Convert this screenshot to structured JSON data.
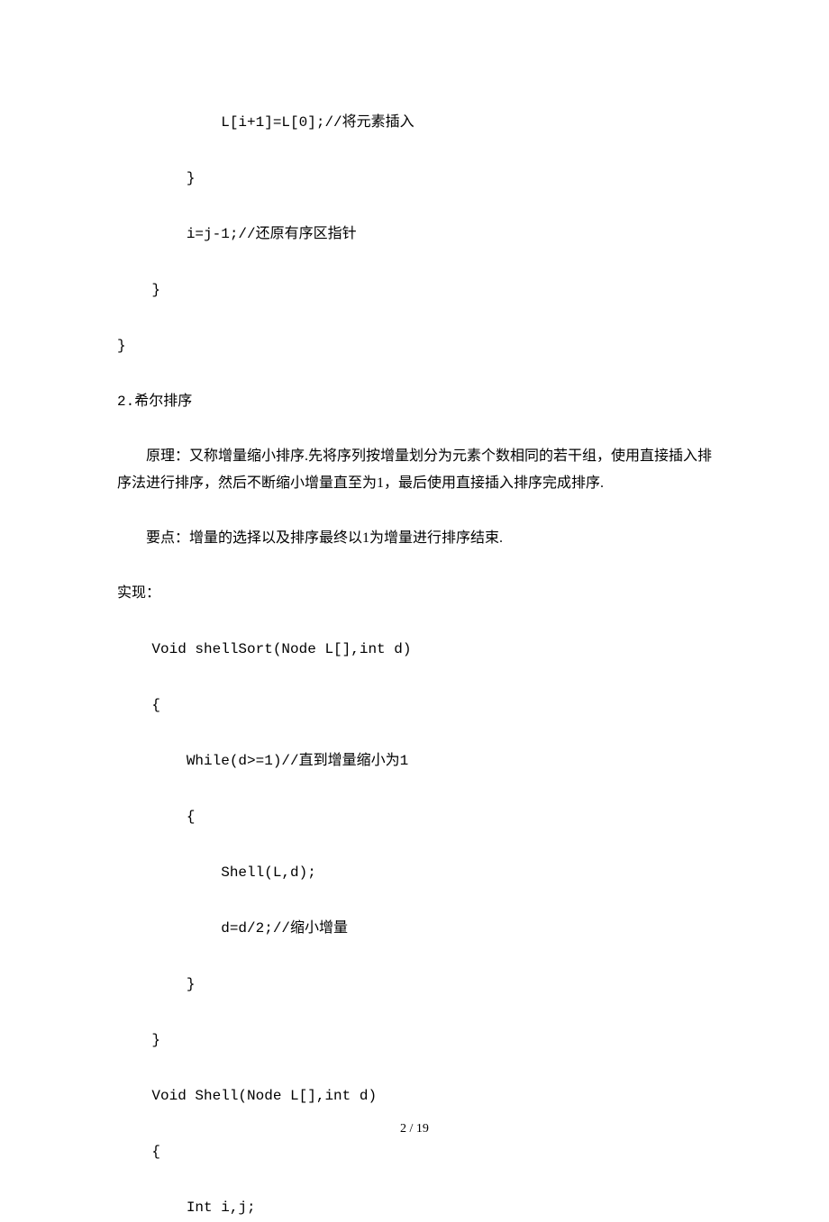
{
  "lines": {
    "l1": "            L[i+1]=L[0];//将元素插入",
    "l2": "        }",
    "l3": "        i=j-1;//还原有序区指针",
    "l4": "    }",
    "l5": "}",
    "l6": "2.希尔排序",
    "l7": "原理：又称增量缩小排序.先将序列按增量划分为元素个数相同的若干组，使用直接插入排序法进行排序，然后不断缩小增量直至为1，最后使用直接插入排序完成排序.",
    "l8": "要点：增量的选择以及排序最终以1为增量进行排序结束.",
    "l9": "实现：",
    "l10": "    Void shellSort(Node L[],int d)",
    "l11": "    {",
    "l12": "        While(d>=1)//直到增量缩小为1",
    "l13": "        {",
    "l14": "            Shell(L,d);",
    "l15": "            d=d/2;//缩小增量",
    "l16": "        }",
    "l17": "    }",
    "l18": "    Void Shell(Node L[],int d)",
    "l19": "    {",
    "l20": "        Int i,j;"
  },
  "footer": "2 / 19"
}
